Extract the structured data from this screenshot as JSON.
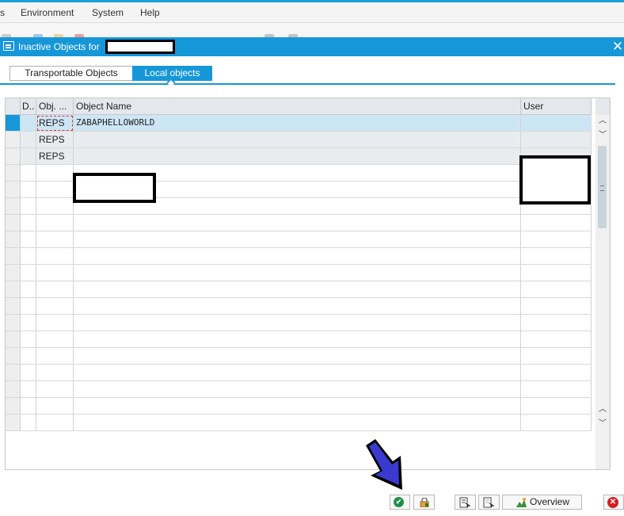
{
  "menu": {
    "items": [
      {
        "label": "s"
      },
      {
        "label": "Environment"
      },
      {
        "label": "System"
      },
      {
        "label": "Help"
      }
    ]
  },
  "dialog": {
    "title": "Inactive Objects for",
    "title_user_redacted": true,
    "close_icon": "close-icon"
  },
  "tabs": [
    {
      "label": "Transportable Objects",
      "active": false
    },
    {
      "label": "Local objects",
      "active": true
    }
  ],
  "table": {
    "columns": [
      "D..",
      "Obj. ...",
      "Object Name",
      "User"
    ],
    "rows": [
      {
        "d": "",
        "obj_type": "REPS",
        "object_name": "ZABAPHELLOWORLD",
        "user": "",
        "selected": true
      },
      {
        "d": "",
        "obj_type": "REPS",
        "object_name": "",
        "user": "",
        "selected": false
      },
      {
        "d": "",
        "obj_type": "REPS",
        "object_name": "",
        "user": "",
        "selected": false
      }
    ],
    "empty_rows": 16
  },
  "footer": {
    "buttons": [
      {
        "name": "activate-button",
        "icon": "check-circle-icon"
      },
      {
        "name": "lock-button",
        "icon": "lock-icon"
      },
      {
        "name": "select-all-button",
        "icon": "select-all-icon"
      },
      {
        "name": "deselect-button",
        "icon": "deselect-icon"
      },
      {
        "name": "overview-button",
        "icon": "overview-icon",
        "label": "Overview"
      },
      {
        "name": "cancel-button",
        "icon": "cancel-icon"
      }
    ]
  },
  "colors": {
    "accent": "#1597d8",
    "selected_row": "#cde6f5",
    "ok_green": "#1e8f4a",
    "cancel_red": "#d21f1f",
    "annotation_arrow": "#3a3ad0"
  }
}
